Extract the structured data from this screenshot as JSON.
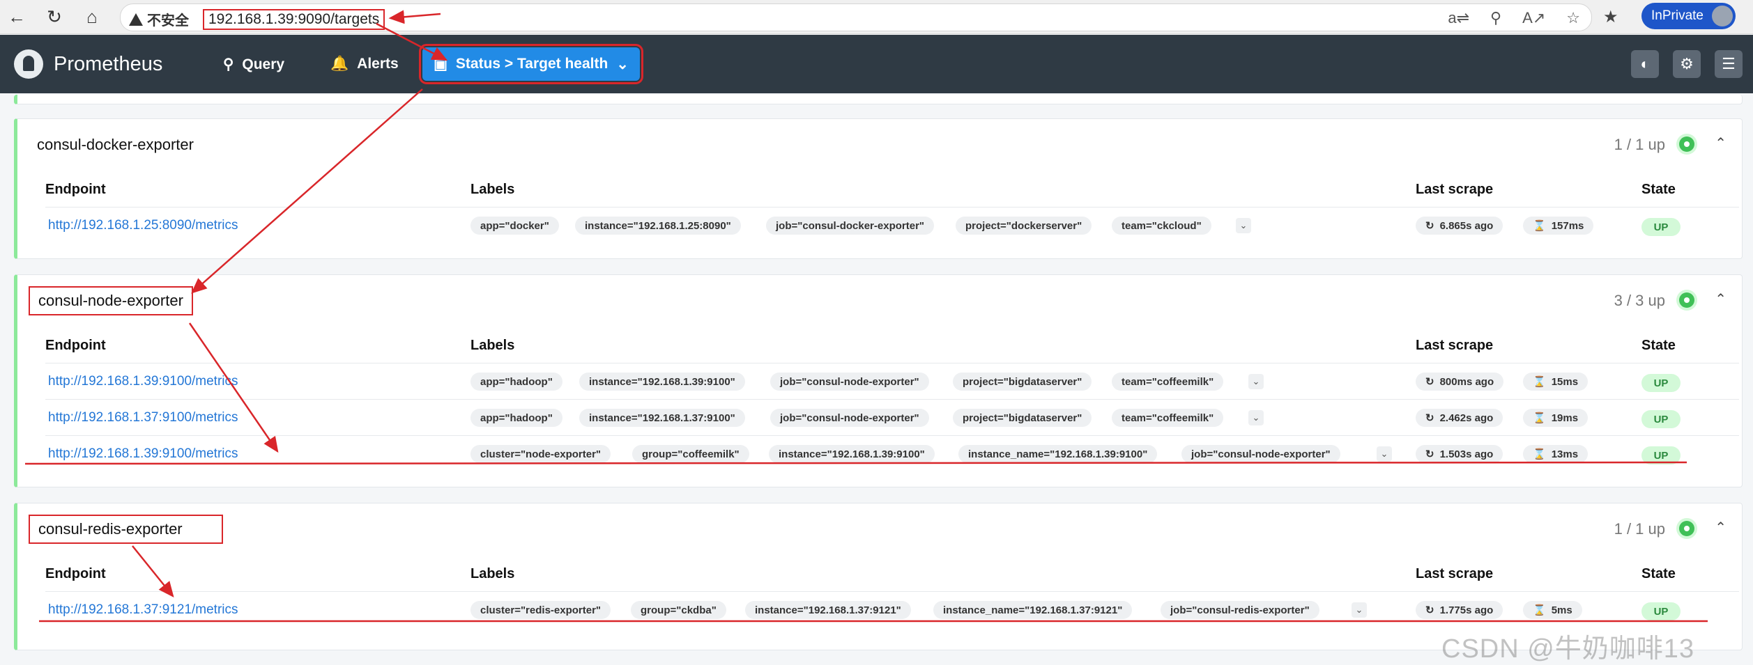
{
  "browser": {
    "security_label": "不安全",
    "url": "192.168.1.39:9090/targets",
    "profile_label": "InPrivate"
  },
  "navbar": {
    "brand": "Prometheus",
    "query": "Query",
    "alerts": "Alerts",
    "status": "Status > Target health"
  },
  "table_headers": {
    "endpoint": "Endpoint",
    "labels": "Labels",
    "last_scrape": "Last scrape",
    "state": "State"
  },
  "pools": [
    {
      "name": "consul-docker-exporter",
      "count": "1 / 1 up",
      "targets": [
        {
          "endpoint": "http://192.168.1.25:8090/metrics",
          "labels": [
            "app=\"docker\"",
            "instance=\"192.168.1.25:8090\"",
            "job=\"consul-docker-exporter\"",
            "project=\"dockerserver\"",
            "team=\"ckcloud\""
          ],
          "last_scrape": "6.865s ago",
          "duration": "157ms",
          "state": "UP"
        }
      ]
    },
    {
      "name": "consul-node-exporter",
      "count": "3 / 3 up",
      "targets": [
        {
          "endpoint": "http://192.168.1.39:9100/metrics",
          "labels": [
            "app=\"hadoop\"",
            "instance=\"192.168.1.39:9100\"",
            "job=\"consul-node-exporter\"",
            "project=\"bigdataserver\"",
            "team=\"coffeemilk\""
          ],
          "last_scrape": "800ms ago",
          "duration": "15ms",
          "state": "UP"
        },
        {
          "endpoint": "http://192.168.1.37:9100/metrics",
          "labels": [
            "app=\"hadoop\"",
            "instance=\"192.168.1.37:9100\"",
            "job=\"consul-node-exporter\"",
            "project=\"bigdataserver\"",
            "team=\"coffeemilk\""
          ],
          "last_scrape": "2.462s ago",
          "duration": "19ms",
          "state": "UP"
        },
        {
          "endpoint": "http://192.168.1.39:9100/metrics",
          "labels": [
            "cluster=\"node-exporter\"",
            "group=\"coffeemilk\"",
            "instance=\"192.168.1.39:9100\"",
            "instance_name=\"192.168.1.39:9100\"",
            "job=\"consul-node-exporter\""
          ],
          "last_scrape": "1.503s ago",
          "duration": "13ms",
          "state": "UP"
        }
      ]
    },
    {
      "name": "consul-redis-exporter",
      "count": "1 / 1 up",
      "targets": [
        {
          "endpoint": "http://192.168.1.37:9121/metrics",
          "labels": [
            "cluster=\"redis-exporter\"",
            "group=\"ckdba\"",
            "instance=\"192.168.1.37:9121\"",
            "instance_name=\"192.168.1.37:9121\"",
            "job=\"consul-redis-exporter\""
          ],
          "last_scrape": "1.775s ago",
          "duration": "5ms",
          "state": "UP"
        }
      ]
    }
  ],
  "watermark": "CSDN @牛奶咖啡13"
}
